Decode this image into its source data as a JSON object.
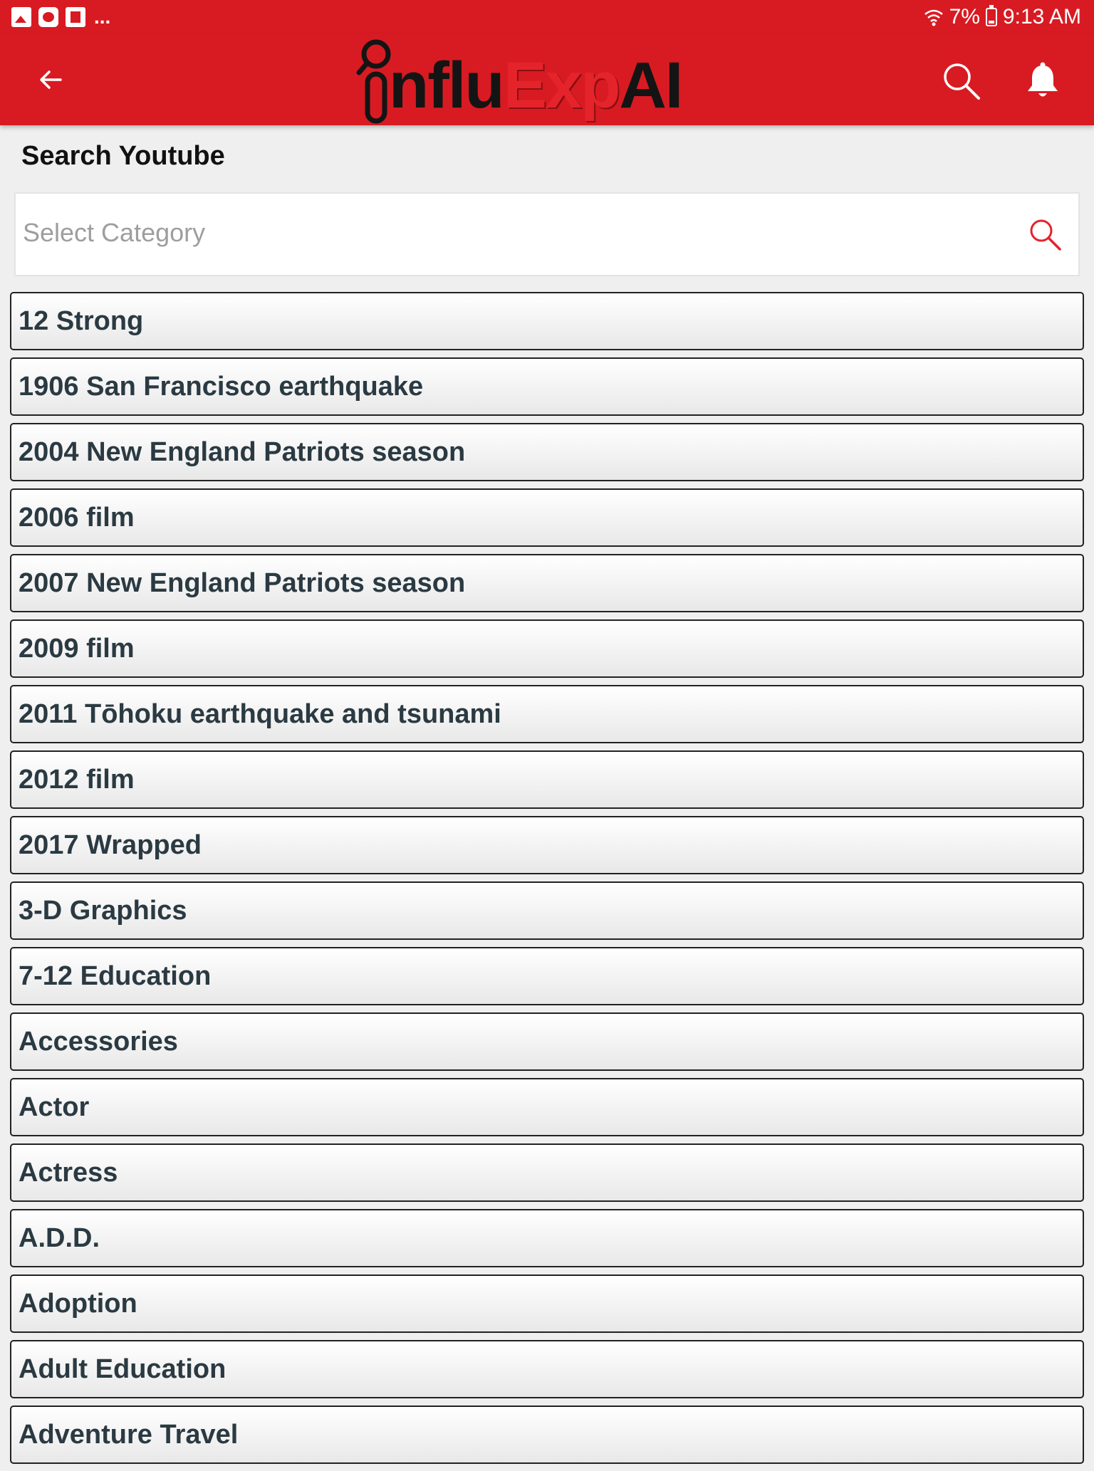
{
  "status_bar": {
    "notification_icons": [
      "image-icon",
      "news-icon",
      "flipboard-icon"
    ],
    "more_indicator": "...",
    "battery": "7%",
    "time": "9:13 AM"
  },
  "app_bar": {
    "back_icon": "arrow-left-icon",
    "logo": {
      "part1": "nflu",
      "part2": "Exp",
      "part3": "AI"
    },
    "search_icon": "search-icon",
    "notifications_icon": "bell-icon",
    "color": "#d81b22"
  },
  "page": {
    "title": "Search Youtube",
    "search": {
      "placeholder": "Select Category",
      "value": ""
    }
  },
  "categories": [
    "12 Strong",
    "1906 San Francisco earthquake",
    "2004 New England Patriots season",
    "2006 film",
    "2007 New England Patriots season",
    "2009 film",
    "2011 Tōhoku earthquake and tsunami",
    "2012 film",
    "2017 Wrapped",
    "3-D Graphics",
    "7-12 Education",
    "Accessories",
    "Actor",
    "Actress",
    "A.D.D.",
    "Adoption",
    "Adult Education",
    "Adventure Travel"
  ]
}
